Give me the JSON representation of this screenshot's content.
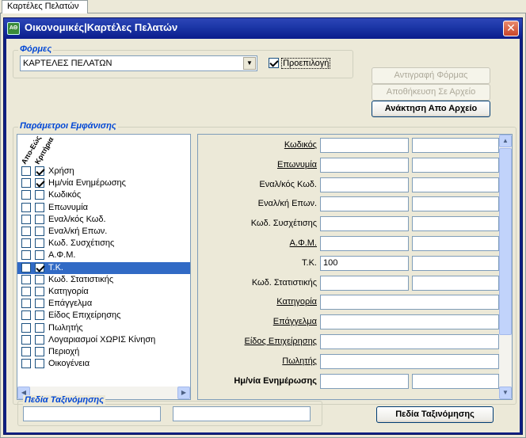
{
  "tab": {
    "label": "Καρτέλες Πελατών"
  },
  "window": {
    "title": "Οικονομικές|Καρτέλες Πελατών",
    "icon": "app-icon",
    "close_label": "✕"
  },
  "forms": {
    "group_label": "Φόρμες",
    "combo_value": "ΚΑΡΤΕΛΕΣ ΠΕΛΑΤΩΝ",
    "default_label": "Προεπιλογή",
    "default_checked": true
  },
  "buttons": {
    "copy_form": "Αντιγραφή Φόρμας",
    "save_to_file": "Αποθήκευση Σε Αρχείο",
    "load_from_file": "Ανάκτηση Απο Αρχείο",
    "sort_fields": "Πεδία Ταξινόμησης"
  },
  "display": {
    "group_label": "Παράμετροι Εμφάνισης",
    "col_from_to": "Απο-Εώς",
    "col_criteria": "Κριτήρια",
    "items": [
      {
        "label": "Χρήση",
        "c1": false,
        "c2": true
      },
      {
        "label": "Ημ/νία Ενημέρωσης",
        "c1": false,
        "c2": true
      },
      {
        "label": "Κωδικός",
        "c1": false,
        "c2": false
      },
      {
        "label": "Επωνυμία",
        "c1": false,
        "c2": false
      },
      {
        "label": "Εναλ/κός Κωδ.",
        "c1": false,
        "c2": false
      },
      {
        "label": "Εναλ/κή Επων.",
        "c1": false,
        "c2": false
      },
      {
        "label": "Κωδ. Συσχέτισης",
        "c1": false,
        "c2": false
      },
      {
        "label": "Α.Φ.Μ.",
        "c1": false,
        "c2": false
      },
      {
        "label": "Τ.Κ.",
        "c1": false,
        "c2": true,
        "selected": true
      },
      {
        "label": "Κωδ. Στατιστικής",
        "c1": false,
        "c2": false
      },
      {
        "label": "Κατηγορία",
        "c1": false,
        "c2": false
      },
      {
        "label": "Επάγγελμα",
        "c1": false,
        "c2": false
      },
      {
        "label": "Είδος Επιχείρησης",
        "c1": false,
        "c2": false
      },
      {
        "label": "Πωλητής",
        "c1": false,
        "c2": false
      },
      {
        "label": "Λογαριασμοί ΧΩΡΙΣ Κίνηση",
        "c1": false,
        "c2": false
      },
      {
        "label": "Περιοχή",
        "c1": false,
        "c2": false
      },
      {
        "label": "Οικογένεια",
        "c1": false,
        "c2": false
      }
    ],
    "fields": [
      {
        "label": "Κωδικός",
        "style": "u",
        "v1": "",
        "v2": "",
        "two": true
      },
      {
        "label": "Επωνυμία",
        "style": "u",
        "v1": "",
        "v2": "",
        "two": true
      },
      {
        "label": "Εναλ/κός Κωδ.",
        "style": "",
        "v1": "",
        "v2": "",
        "two": true
      },
      {
        "label": "Εναλ/κή Επων.",
        "style": "",
        "v1": "",
        "v2": "",
        "two": true
      },
      {
        "label": "Κωδ. Συσχέτισης",
        "style": "",
        "v1": "",
        "v2": "",
        "two": true
      },
      {
        "label": "Α.Φ.Μ.",
        "style": "u",
        "v1": "",
        "v2": "",
        "two": true
      },
      {
        "label": "Τ.Κ.",
        "style": "",
        "v1": "100",
        "v2": "",
        "two": true
      },
      {
        "label": "Κωδ. Στατιστικής",
        "style": "",
        "v1": "",
        "v2": "",
        "two": true
      },
      {
        "label": "Κατηγορία",
        "style": "u",
        "v1": "",
        "two": false
      },
      {
        "label": "Επάγγελμα",
        "style": "u",
        "v1": "",
        "two": false
      },
      {
        "label": "Είδος Επιχείρησης",
        "style": "u",
        "v1": "",
        "two": false
      },
      {
        "label": "Πωλητής",
        "style": "u",
        "v1": "",
        "two": false
      },
      {
        "label": "Ημ/νία Ενημέρωσης",
        "style": "b",
        "v1": "",
        "v2": "",
        "two": true
      }
    ]
  },
  "sorting": {
    "group_label": "Πεδία Ταξινόμησης",
    "field1": "",
    "field2": ""
  }
}
